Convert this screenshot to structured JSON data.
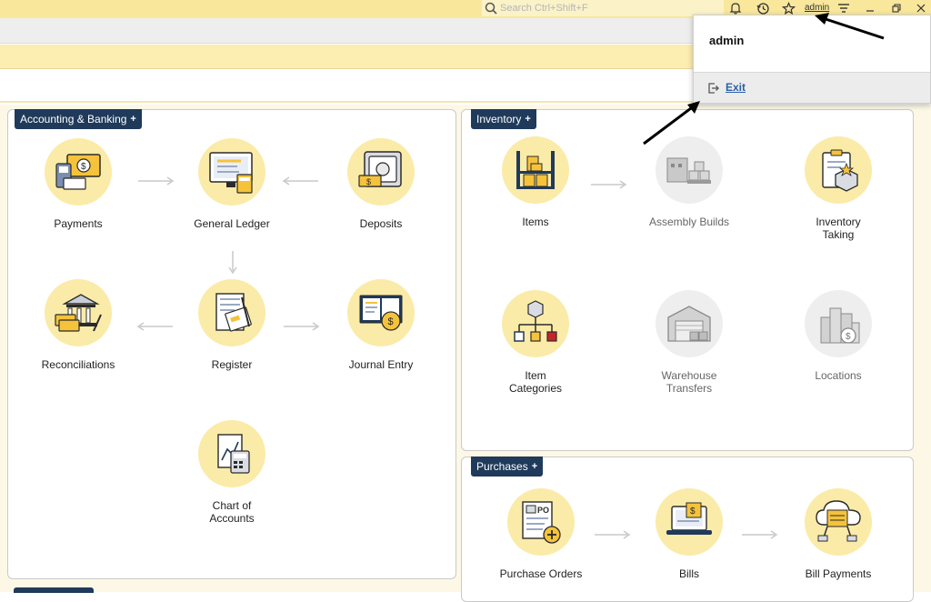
{
  "topbar": {
    "search_placeholder": "Search Ctrl+Shift+F",
    "user_link": "admin",
    "icons": [
      "search-icon",
      "bell-icon",
      "history-icon",
      "star-icon",
      "menu-icon",
      "minimize-icon",
      "restore-icon",
      "close-icon"
    ]
  },
  "user_menu": {
    "username": "admin",
    "exit_label": "Exit"
  },
  "accounting": {
    "tab_label": "Accounting & Banking",
    "items": [
      {
        "label": "Payments"
      },
      {
        "label": "General Ledger"
      },
      {
        "label": "Deposits"
      },
      {
        "label": "Reconciliations"
      },
      {
        "label": "Register"
      },
      {
        "label": "Journal Entry"
      },
      {
        "label": "Chart of Accounts"
      }
    ]
  },
  "inventory": {
    "tab_label": "Inventory",
    "items": [
      {
        "label": "Items"
      },
      {
        "label": "Assembly Builds"
      },
      {
        "label": "Inventory Taking"
      },
      {
        "label": "Item Categories"
      },
      {
        "label": "Warehouse Transfers"
      },
      {
        "label": "Locations"
      }
    ]
  },
  "purchases": {
    "tab_label": "Purchases",
    "items": [
      {
        "label": "Purchase Orders"
      },
      {
        "label": "Bills"
      },
      {
        "label": "Bill Payments"
      }
    ]
  },
  "colors": {
    "accent_yellow": "#f9e79c",
    "icon_circle": "#fbeba8",
    "tab_navy": "#1f3a5a",
    "link_blue": "#2a5fa8"
  }
}
